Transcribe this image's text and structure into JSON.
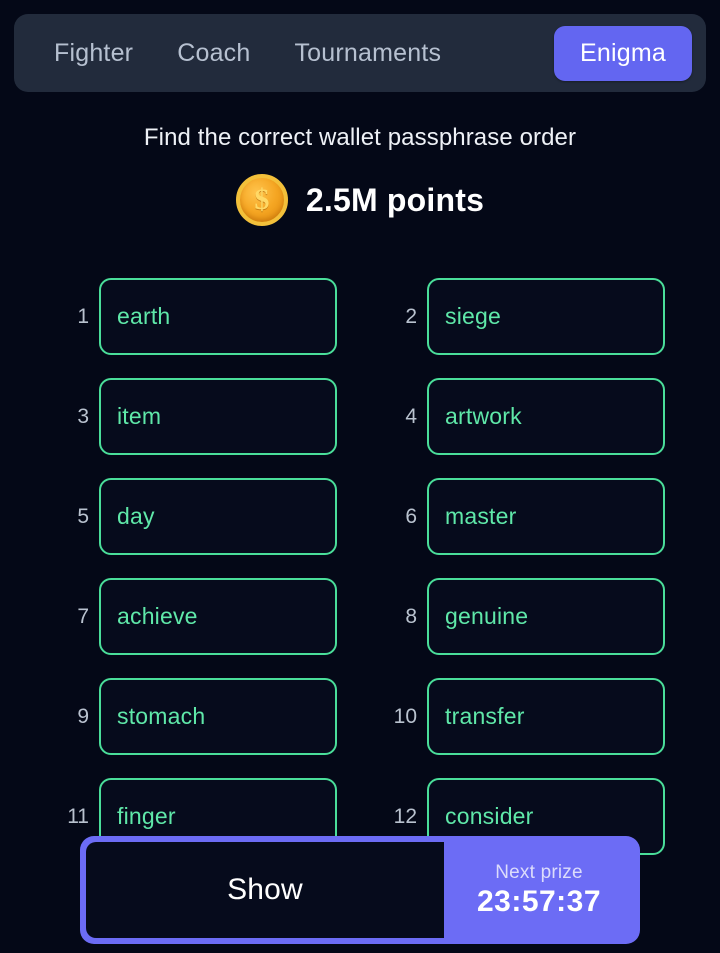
{
  "nav": {
    "tabs": [
      {
        "label": "Fighter",
        "active": false
      },
      {
        "label": "Coach",
        "active": false
      },
      {
        "label": "Tournaments",
        "active": false
      },
      {
        "label": "Enigma",
        "active": true
      }
    ]
  },
  "header": {
    "headline": "Find the correct wallet passphrase order"
  },
  "points": {
    "icon": "coin-icon",
    "coin_symbol": "$",
    "amount": "2.5M points"
  },
  "grid": {
    "cells": [
      {
        "index": "1",
        "word": "earth"
      },
      {
        "index": "2",
        "word": "siege"
      },
      {
        "index": "3",
        "word": "item"
      },
      {
        "index": "4",
        "word": "artwork"
      },
      {
        "index": "5",
        "word": "day"
      },
      {
        "index": "6",
        "word": "master"
      },
      {
        "index": "7",
        "word": "achieve"
      },
      {
        "index": "8",
        "word": "genuine"
      },
      {
        "index": "9",
        "word": "stomach"
      },
      {
        "index": "10",
        "word": "transfer"
      },
      {
        "index": "11",
        "word": "finger"
      },
      {
        "index": "12",
        "word": "consider"
      }
    ]
  },
  "actions": {
    "show_label": "Show",
    "prize_label": "Next prize",
    "prize_timer": "23:57:37"
  },
  "colors": {
    "page_background": "#040817",
    "navbar_background": "#222b3c",
    "accent_purple": "#6366f1",
    "accent_purple_light": "#6c6cf5",
    "word_border_green": "#4ade9a",
    "word_text_green": "#5fe8a9",
    "coin_gold": "#f5a623",
    "inactive_tab_text": "#b6c0d0"
  }
}
